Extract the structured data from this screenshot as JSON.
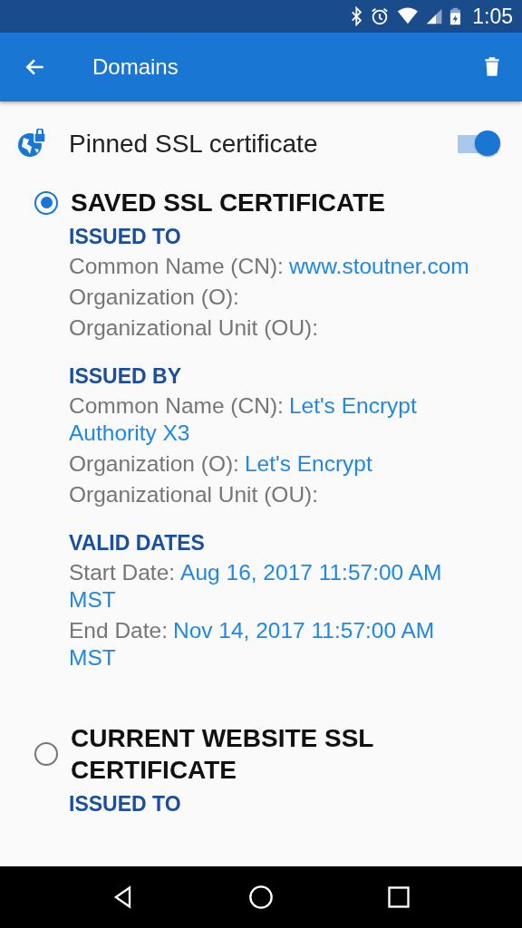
{
  "status_bar": {
    "time": "1:05"
  },
  "app_bar": {
    "title": "Domains"
  },
  "pinned": {
    "label": "Pinned SSL certificate",
    "on": true
  },
  "certificates": [
    {
      "title": "SAVED SSL CERTIFICATE",
      "selected": true,
      "sections": [
        {
          "title": "ISSUED TO",
          "fields": [
            {
              "label": "Common Name (CN):",
              "value": "www.stoutner.com"
            },
            {
              "label": "Organization (O):"
            },
            {
              "label": "Organizational Unit (OU):"
            }
          ]
        },
        {
          "title": "ISSUED BY",
          "fields": [
            {
              "label": "Common Name (CN):",
              "value": "Let's Encrypt Authority X3"
            },
            {
              "label": "Organization (O):",
              "value": "Let's Encrypt"
            },
            {
              "label": "Organizational Unit (OU):"
            }
          ]
        },
        {
          "title": "VALID DATES",
          "fields": [
            {
              "label": "Start Date:",
              "value": "Aug 16, 2017 11:57:00 AM MST"
            },
            {
              "label": "End Date:",
              "value": "Nov 14, 2017 11:57:00 AM MST"
            }
          ]
        }
      ]
    },
    {
      "title": "CURRENT WEBSITE SSL CERTIFICATE",
      "selected": false,
      "sections": [
        {
          "title": "ISSUED TO"
        }
      ]
    }
  ]
}
